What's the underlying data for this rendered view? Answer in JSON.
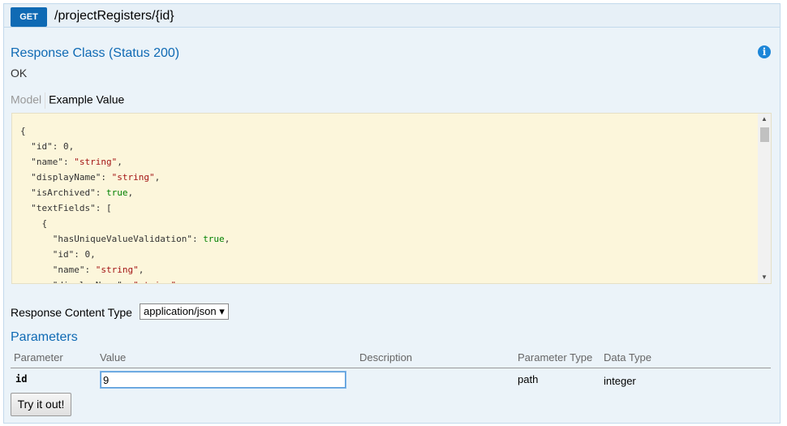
{
  "endpoint": {
    "method": "GET",
    "path": "/projectRegisters/{id}"
  },
  "response_class": {
    "title": "Response Class (Status 200)",
    "status_text": "OK"
  },
  "tabs": {
    "model": "Model",
    "example": "Example Value"
  },
  "example_json": [
    [
      {
        "t": "p",
        "v": "{"
      }
    ],
    [
      {
        "t": "p",
        "v": "  "
      },
      {
        "t": "k",
        "v": "\"id\""
      },
      {
        "t": "p",
        "v": ": "
      },
      {
        "t": "n",
        "v": "0"
      },
      {
        "t": "p",
        "v": ","
      }
    ],
    [
      {
        "t": "p",
        "v": "  "
      },
      {
        "t": "k",
        "v": "\"name\""
      },
      {
        "t": "p",
        "v": ": "
      },
      {
        "t": "s",
        "v": "\"string\""
      },
      {
        "t": "p",
        "v": ","
      }
    ],
    [
      {
        "t": "p",
        "v": "  "
      },
      {
        "t": "k",
        "v": "\"displayName\""
      },
      {
        "t": "p",
        "v": ": "
      },
      {
        "t": "s",
        "v": "\"string\""
      },
      {
        "t": "p",
        "v": ","
      }
    ],
    [
      {
        "t": "p",
        "v": "  "
      },
      {
        "t": "k",
        "v": "\"isArchived\""
      },
      {
        "t": "p",
        "v": ": "
      },
      {
        "t": "b",
        "v": "true"
      },
      {
        "t": "p",
        "v": ","
      }
    ],
    [
      {
        "t": "p",
        "v": "  "
      },
      {
        "t": "k",
        "v": "\"textFields\""
      },
      {
        "t": "p",
        "v": ": ["
      }
    ],
    [
      {
        "t": "p",
        "v": "    {"
      }
    ],
    [
      {
        "t": "p",
        "v": "      "
      },
      {
        "t": "k",
        "v": "\"hasUniqueValueValidation\""
      },
      {
        "t": "p",
        "v": ": "
      },
      {
        "t": "b",
        "v": "true"
      },
      {
        "t": "p",
        "v": ","
      }
    ],
    [
      {
        "t": "p",
        "v": "      "
      },
      {
        "t": "k",
        "v": "\"id\""
      },
      {
        "t": "p",
        "v": ": "
      },
      {
        "t": "n",
        "v": "0"
      },
      {
        "t": "p",
        "v": ","
      }
    ],
    [
      {
        "t": "p",
        "v": "      "
      },
      {
        "t": "k",
        "v": "\"name\""
      },
      {
        "t": "p",
        "v": ": "
      },
      {
        "t": "s",
        "v": "\"string\""
      },
      {
        "t": "p",
        "v": ","
      }
    ],
    [
      {
        "t": "p",
        "v": "      "
      },
      {
        "t": "k",
        "v": "\"displayName\""
      },
      {
        "t": "p",
        "v": ": "
      },
      {
        "t": "s",
        "v": "\"string\""
      }
    ]
  ],
  "response_content_type": {
    "label": "Response Content Type",
    "selected": "application/json ▾"
  },
  "parameters": {
    "title": "Parameters",
    "headers": [
      "Parameter",
      "Value",
      "Description",
      "Parameter Type",
      "Data Type"
    ],
    "row": {
      "name": "id",
      "value": "9",
      "description": "",
      "param_type": "path",
      "data_type": "integer"
    }
  },
  "try_button": "Try it out!",
  "icons": {
    "info": "info-icon"
  },
  "colors": {
    "accent": "#0f6ab4",
    "code_bg": "#fcf6db"
  }
}
